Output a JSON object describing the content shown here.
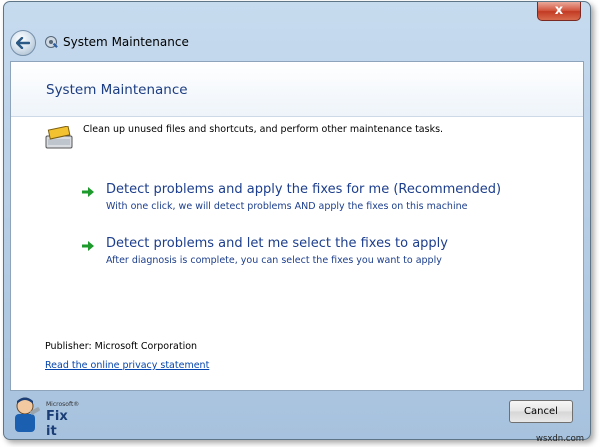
{
  "window": {
    "title": "System Maintenance",
    "close_label": "x"
  },
  "header": {
    "title": "System Maintenance"
  },
  "description": "Clean up unused files and shortcuts, and perform other maintenance tasks.",
  "options": [
    {
      "label": "Detect problems and apply the fixes for me (Recommended)",
      "sub": "With one click, we will detect problems AND apply the fixes on this machine"
    },
    {
      "label": "Detect problems and let me select the fixes to apply",
      "sub": "After diagnosis is complete, you can select the fixes you want to apply"
    }
  ],
  "publisher": "Publisher: Microsoft Corporation",
  "privacy_link": "Read the online privacy statement",
  "logo": {
    "brand_small": "Microsoft®",
    "brand_big": "Fix it"
  },
  "cancel_label": "Cancel",
  "watermark": "wsxdn.com",
  "colors": {
    "accent": "#1c3e8c",
    "arrow_green": "#1e9a2c",
    "link": "#0645ad"
  }
}
